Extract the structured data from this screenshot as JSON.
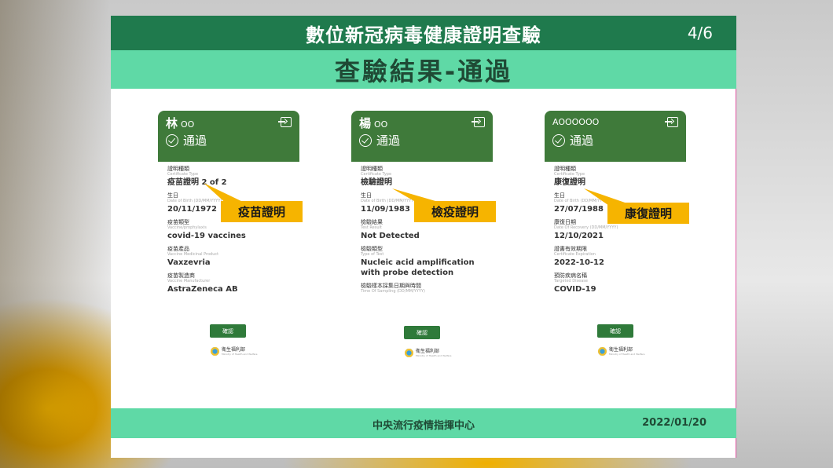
{
  "header": {
    "title": "數位新冠病毒健康證明查驗",
    "page": "4/6",
    "subtitle": "查驗結果-通過"
  },
  "cards": [
    {
      "name": "林",
      "name_suffix": "OO",
      "status": "通過",
      "callout": "疫苗證明",
      "fields": [
        {
          "zh": "證明種類",
          "en": "Certificate Type",
          "value": "疫苗證明 2 of 2"
        },
        {
          "zh": "生日",
          "en": "Date of Birth (DD/MM/YYYY)",
          "value": "20/11/1972"
        },
        {
          "zh": "疫苗類型",
          "en": "Vaccine/prophylaxis",
          "value": "covid-19 vaccines"
        },
        {
          "zh": "疫苗產品",
          "en": "Vaccine Medicinal Product",
          "value": "Vaxzevria"
        },
        {
          "zh": "疫苗製造商",
          "en": "Vaccine Manufacturer",
          "value": "AstraZeneca AB"
        }
      ],
      "confirm": "確認"
    },
    {
      "name": "楊",
      "name_suffix": "OO",
      "status": "通過",
      "callout": "檢疫證明",
      "fields": [
        {
          "zh": "證明種類",
          "en": "Certificate Type",
          "value": "檢驗證明"
        },
        {
          "zh": "生日",
          "en": "Date of Birth (DD/MM/YYYY)",
          "value": "11/09/1983"
        },
        {
          "zh": "檢驗結果",
          "en": "Test Result",
          "value": "Not Detected"
        },
        {
          "zh": "檢驗類型",
          "en": "Type of Test",
          "value": "Nucleic acid amplification with probe detection"
        },
        {
          "zh": "檢驗樣本採集日期與時間",
          "en": "Time Of Sampling (DD/MM/YYYY)",
          "value": ""
        }
      ],
      "confirm": "確認"
    },
    {
      "name": "AOOOOOO",
      "name_suffix": "",
      "status": "通過",
      "callout": "康復證明",
      "fields": [
        {
          "zh": "證明種類",
          "en": "Certificate Type",
          "value": "康復證明"
        },
        {
          "zh": "生日",
          "en": "Date of Birth (DD/MM/YYYY)",
          "value": "27/07/1988"
        },
        {
          "zh": "康復日期",
          "en": "Date Of Recovery (DD/MM/YYYY)",
          "value": "12/10/2021"
        },
        {
          "zh": "證書有效期限",
          "en": "Certificate Expiration",
          "value": "2022-10-12"
        },
        {
          "zh": "預防疾病名稱",
          "en": "Targeted Disease",
          "value": "COVID-19"
        }
      ],
      "confirm": "確認"
    }
  ],
  "ministry": {
    "name": "衛生福利部",
    "en": "Ministry of Health and Welfare"
  },
  "footer": {
    "center": "中央流行疫情指揮中心",
    "date": "2022/01/20"
  },
  "colors": {
    "dark_green": "#1f7a4d",
    "mint": "#5fd9a6",
    "card_green": "#3f7a3a",
    "callout_yellow": "#f6b400"
  }
}
